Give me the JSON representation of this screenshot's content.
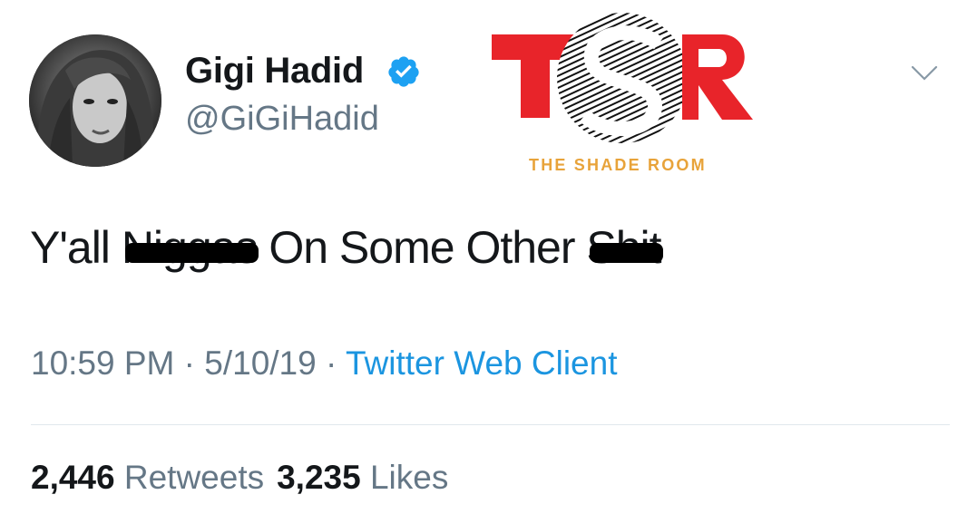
{
  "user": {
    "display_name": "Gigi Hadid",
    "handle": "@GiGiHadid",
    "verified": true
  },
  "overlay": {
    "logo_text": "TSR",
    "tagline": "THE SHADE ROOM",
    "brand_colors": [
      "#e8242a",
      "#e8a33a"
    ]
  },
  "tweet": {
    "text_before": "Y'all ",
    "censored_word_1": "Niggas",
    "text_middle": " On Some Other ",
    "censored_word_2": "Shit"
  },
  "meta": {
    "time": "10:59 PM",
    "separator": "·",
    "date": "5/10/19",
    "source": "Twitter Web Client"
  },
  "stats": {
    "retweets_count": "2,446",
    "retweets_label": "Retweets",
    "likes_count": "3,235",
    "likes_label": "Likes"
  },
  "icons": {
    "verified": "verified-badge-icon",
    "menu": "chevron-down-icon"
  }
}
